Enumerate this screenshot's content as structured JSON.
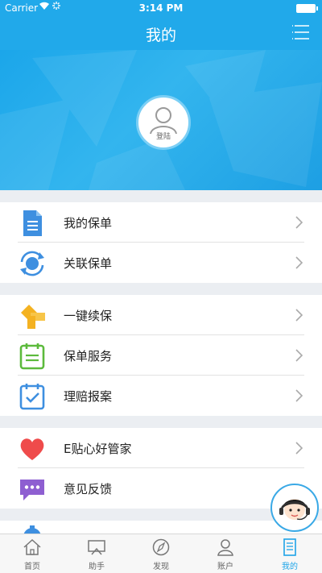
{
  "status": {
    "carrier": "Carrier",
    "time": "3:14 PM"
  },
  "nav": {
    "title": "我的"
  },
  "profile": {
    "login_label": "登陆"
  },
  "groups": [
    {
      "items": [
        {
          "label": "我的保单",
          "icon": "document-icon"
        },
        {
          "label": "关联保单",
          "icon": "sync-icon"
        }
      ]
    },
    {
      "items": [
        {
          "label": "一键续保",
          "icon": "renew-icon"
        },
        {
          "label": "保单服务",
          "icon": "clipboard-icon"
        },
        {
          "label": "理赔报案",
          "icon": "calendar-check-icon"
        }
      ]
    },
    {
      "items": [
        {
          "label": "E贴心好管家",
          "icon": "heart-icon"
        },
        {
          "label": "意见反馈",
          "icon": "chat-icon"
        }
      ]
    }
  ],
  "tabs": [
    {
      "label": "首页",
      "icon": "home-icon"
    },
    {
      "label": "助手",
      "icon": "assistant-icon"
    },
    {
      "label": "发现",
      "icon": "compass-icon"
    },
    {
      "label": "账户",
      "icon": "user-icon"
    },
    {
      "label": "我的",
      "icon": "document-icon"
    }
  ],
  "colors": {
    "primary": "#21a9ea",
    "active_tab": "#1ea4e8",
    "heart": "#ef4b4b",
    "chat": "#8e5fd1",
    "renew": "#f4b221",
    "clipboard": "#5cba3c",
    "document": "#3e8fe0"
  }
}
